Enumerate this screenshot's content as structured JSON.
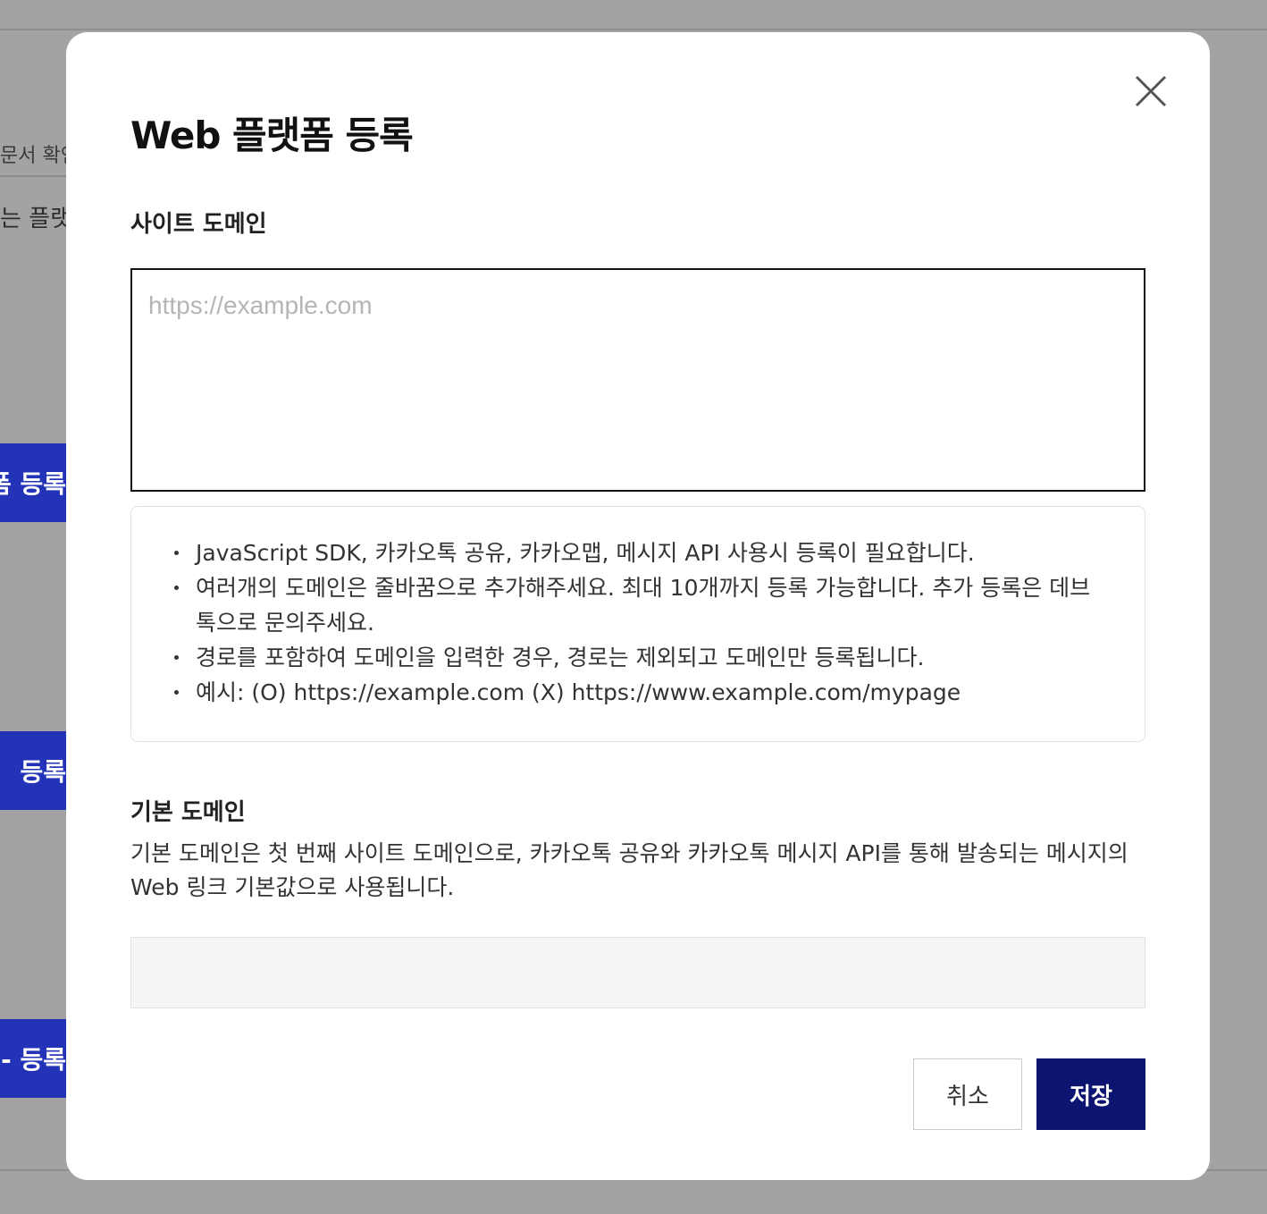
{
  "background": {
    "doc_link_text": "문서 확인",
    "intro_text": "는 플랫폼",
    "buttons": [
      {
        "label": "랫폼 등록"
      },
      {
        "label": "등록"
      },
      {
        "label": "- 등록"
      }
    ]
  },
  "modal": {
    "title": "Web 플랫폼 등록",
    "close_icon": "close-icon",
    "site_domain": {
      "label": "사이트 도메인",
      "placeholder": "https://example.com",
      "value": ""
    },
    "info_items": [
      "JavaScript SDK, 카카오톡 공유, 카카오맵, 메시지 API 사용시 등록이 필요합니다.",
      "여러개의 도메인은 줄바꿈으로 추가해주세요. 최대 10개까지 등록 가능합니다. 추가 등록은 데브톡으로 문의주세요.",
      "경로를 포함하여 도메인을 입력한 경우, 경로는 제외되고 도메인만 등록됩니다.",
      "예시: (O) https://example.com (X) https://www.example.com/mypage"
    ],
    "default_domain": {
      "label": "기본 도메인",
      "description": "기본 도메인은 첫 번째 사이트 도메인으로, 카카오톡 공유와 카카오톡 메시지 API를 통해 발송되는 메시지의 Web 링크 기본값으로 사용됩니다.",
      "value": ""
    },
    "cancel_label": "취소",
    "save_label": "저장"
  },
  "colors": {
    "overlay": "#a3a3a3",
    "background_button": "#2233b8",
    "save_button": "#0b1470",
    "input_border": "#111111"
  }
}
